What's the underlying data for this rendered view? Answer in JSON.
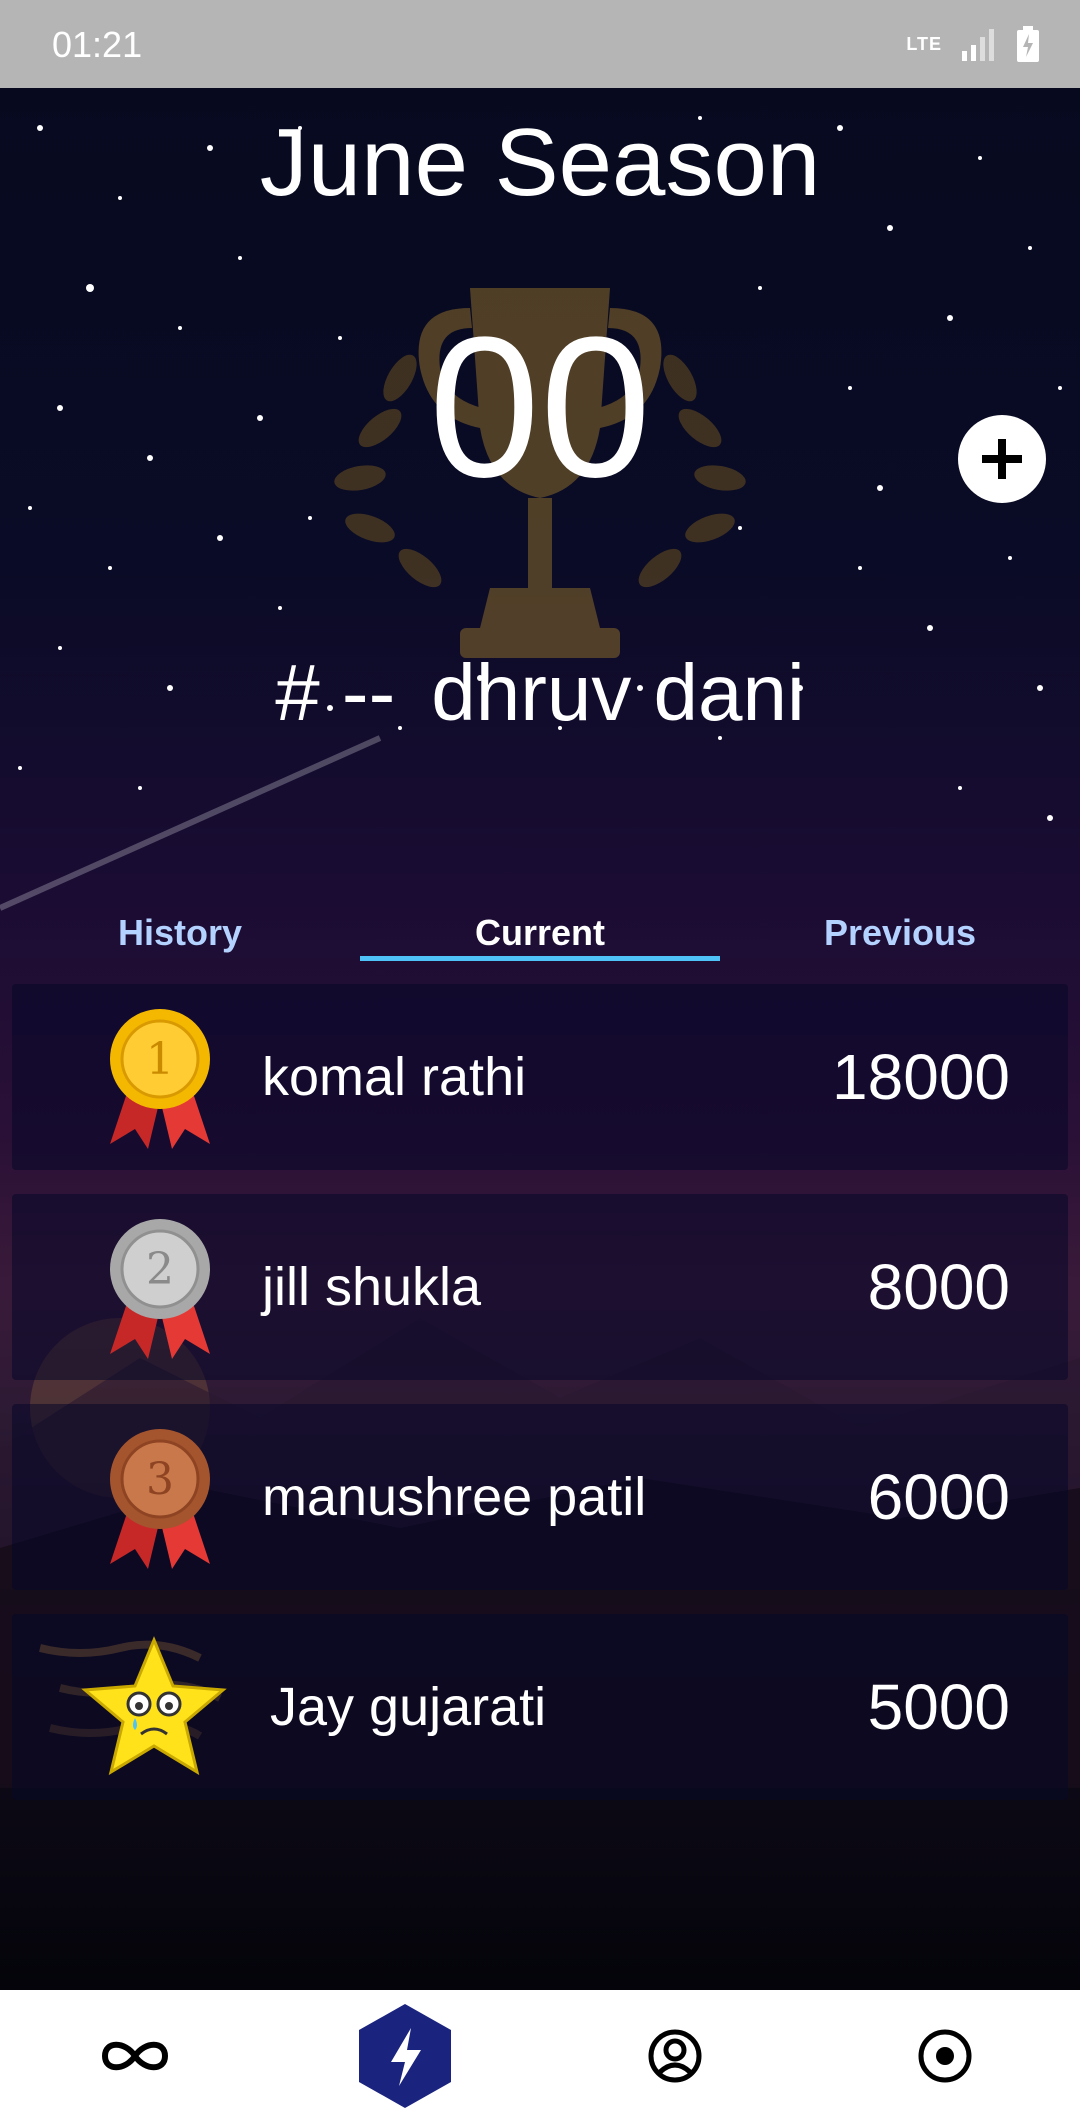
{
  "status_bar": {
    "time": "01:21",
    "network": "LTE"
  },
  "header": {
    "season_title": "June Season",
    "points": "00"
  },
  "user": {
    "rank": "# --",
    "name": "dhruv dani"
  },
  "tabs": [
    {
      "label": "History",
      "active": false
    },
    {
      "label": "Current",
      "active": true
    },
    {
      "label": "Previous",
      "active": false
    }
  ],
  "leaderboard": [
    {
      "name": "komal rathi",
      "score": "18000",
      "badge": "gold-medal-icon"
    },
    {
      "name": "jill shukla",
      "score": "8000",
      "badge": "silver-medal-icon"
    },
    {
      "name": "manushree patil",
      "score": "6000",
      "badge": "bronze-medal-icon"
    },
    {
      "name": "Jay gujarati",
      "score": "5000",
      "badge": "sad-star-icon"
    }
  ],
  "medal_numbers": [
    "1",
    "2",
    "3"
  ],
  "bottom_nav": [
    {
      "icon": "infinity-icon",
      "active": false
    },
    {
      "icon": "lightning-icon",
      "active": true
    },
    {
      "icon": "profile-icon",
      "active": false
    },
    {
      "icon": "record-icon",
      "active": false
    }
  ],
  "colors": {
    "accent": "#4fc3f7",
    "tab_inactive": "#b4d2ff",
    "nav_active": "#1a237e",
    "gold": "#f5b800",
    "silver": "#b9b9b9",
    "bronze": "#b8643a",
    "star": "#ffe21a"
  }
}
